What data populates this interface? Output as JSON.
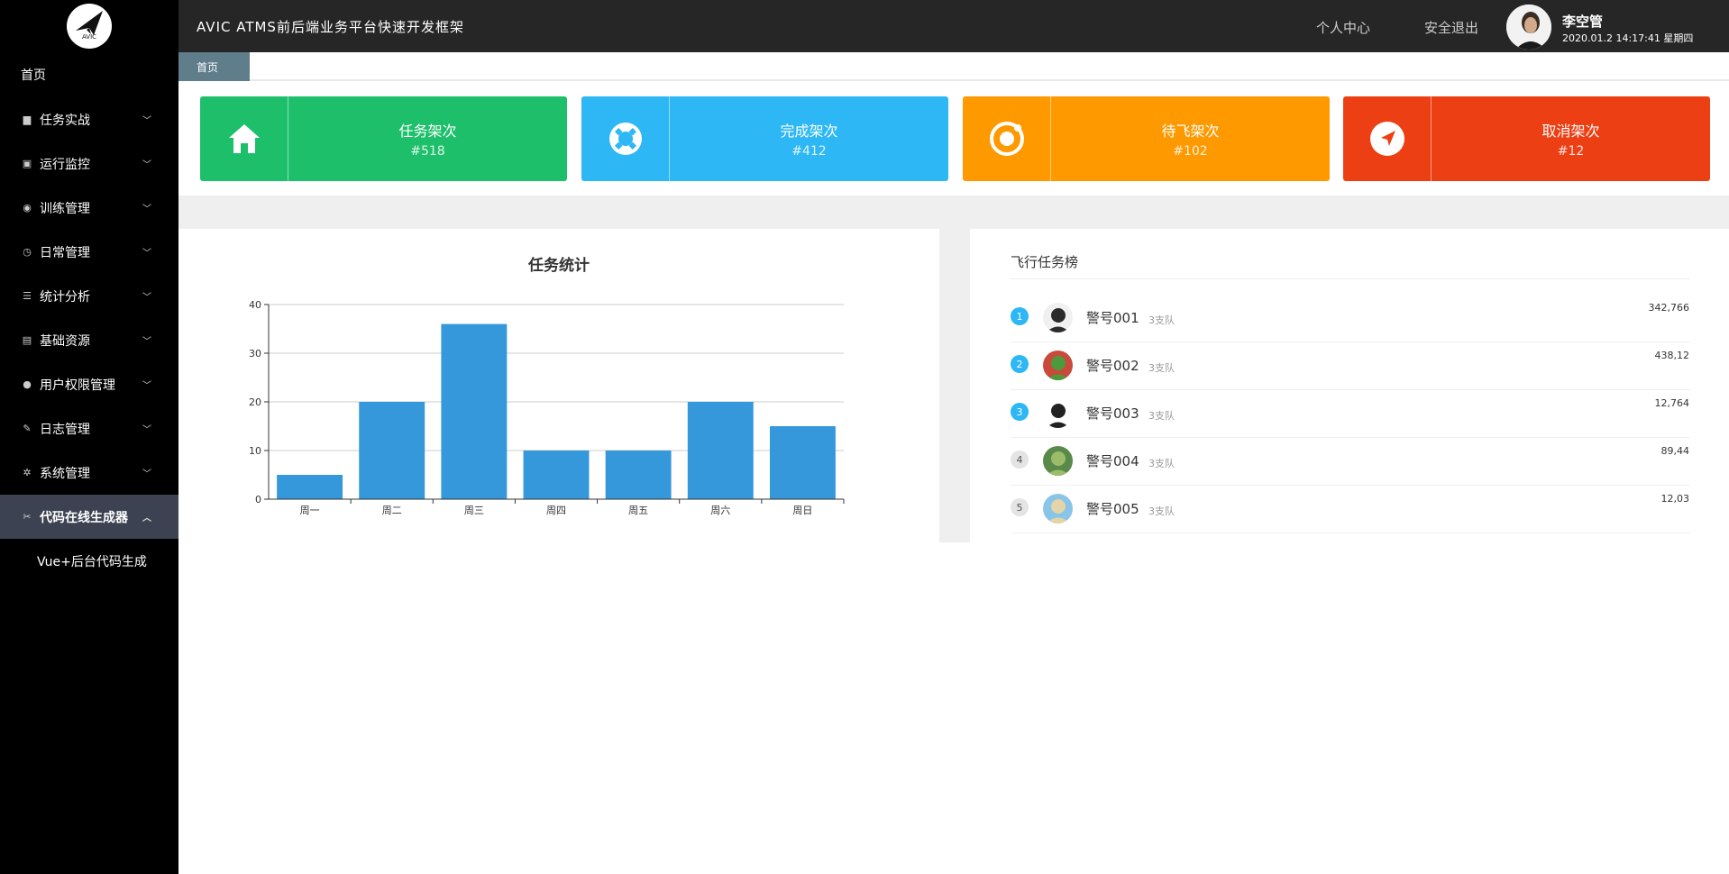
{
  "sidebar": {
    "logo_text": "AVIC",
    "home_label": "首页",
    "items": [
      {
        "label": "任务实战",
        "icon": "briefcase-icon"
      },
      {
        "label": "运行监控",
        "icon": "chart-icon"
      },
      {
        "label": "训练管理",
        "icon": "globe-icon"
      },
      {
        "label": "日常管理",
        "icon": "clock-icon"
      },
      {
        "label": "统计分析",
        "icon": "sliders-icon"
      },
      {
        "label": "基础资源",
        "icon": "document-icon"
      },
      {
        "label": "用户权限管理",
        "icon": "user-icon"
      },
      {
        "label": "日志管理",
        "icon": "edit-icon"
      },
      {
        "label": "系统管理",
        "icon": "gear-icon"
      },
      {
        "label": "代码在线生成器",
        "icon": "tools-icon",
        "active": true
      }
    ],
    "sub_item_label": "Vue+后台代码生成"
  },
  "header": {
    "title": "AVIC ATMS前后端业务平台快速开发框架",
    "links": [
      "个人中心",
      "安全退出"
    ],
    "user_name": "李空管",
    "user_time": "2020.01.2 14:17:41 星期四"
  },
  "breadcrumb": {
    "label": "首页"
  },
  "stats": [
    {
      "title": "任务架次",
      "value": "#518",
      "color": "#1dbf6a",
      "icon": "home-icon"
    },
    {
      "title": "完成架次",
      "value": "#412",
      "color": "#2db7f5",
      "icon": "lifebuoy-icon"
    },
    {
      "title": "待飞架次",
      "value": "#102",
      "color": "#ff9900",
      "icon": "ionic-icon"
    },
    {
      "title": "取消架次",
      "value": "#12",
      "color": "#ed3f14",
      "icon": "navigate-icon"
    }
  ],
  "chart_data": {
    "type": "bar",
    "title": "任务统计",
    "categories": [
      "周一",
      "周二",
      "周三",
      "周四",
      "周五",
      "周六",
      "周日"
    ],
    "values": [
      5,
      20,
      36,
      10,
      10,
      20,
      15
    ],
    "ylim": [
      0,
      40
    ],
    "yticks": [
      0,
      10,
      20,
      30,
      40
    ],
    "color": "#3498db",
    "grid": true
  },
  "ranking": {
    "title": "飞行任务榜",
    "rows": [
      {
        "rank": "1",
        "name": "警号001",
        "team": "3支队",
        "value": "342,766"
      },
      {
        "rank": "2",
        "name": "警号002",
        "team": "3支队",
        "value": "438,12"
      },
      {
        "rank": "3",
        "name": "警号003",
        "team": "3支队",
        "value": "12,764"
      },
      {
        "rank": "4",
        "name": "警号004",
        "team": "3支队",
        "value": "89,44"
      },
      {
        "rank": "5",
        "name": "警号005",
        "team": "3支队",
        "value": "12,03"
      }
    ]
  }
}
